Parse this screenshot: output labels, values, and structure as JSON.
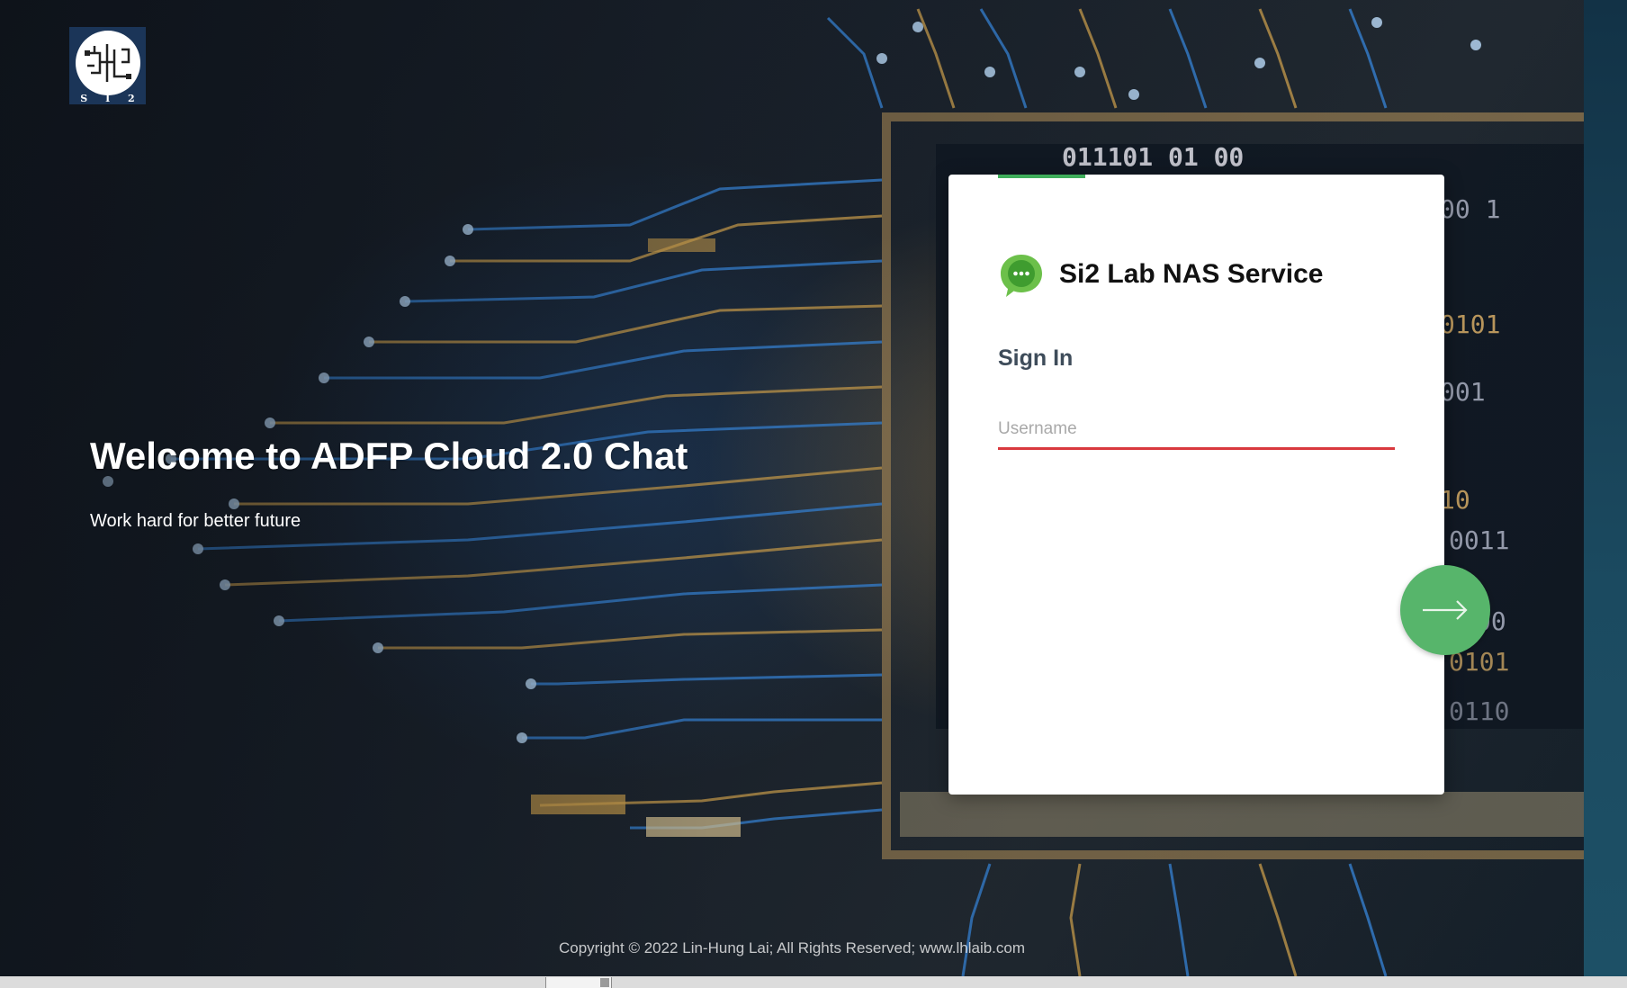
{
  "logo": {
    "letters": "S I 2",
    "icon_name": "si2-lab-logo"
  },
  "hero": {
    "title": "Welcome to ADFP Cloud 2.0 Chat",
    "subtitle": "Work hard for better future"
  },
  "login": {
    "service_name": "Si2 Lab NAS Service",
    "service_icon": "chat-bubble-icon",
    "heading": "Sign In",
    "username_placeholder": "Username",
    "username_value": "",
    "submit_icon": "arrow-right-icon"
  },
  "footer": {
    "copyright": "Copyright © 2022 Lin-Hung Lai; All Rights Reserved; www.lhlaib.com"
  },
  "colors": {
    "accent_green": "#3fae5b",
    "submit_green": "#57b56b",
    "input_underline_red": "#d9393e"
  }
}
